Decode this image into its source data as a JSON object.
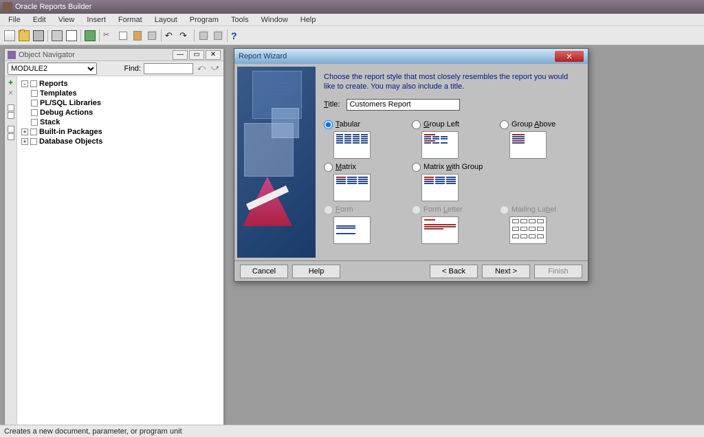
{
  "app": {
    "title": "Oracle Reports Builder"
  },
  "menu": {
    "items": [
      "File",
      "Edit",
      "View",
      "Insert",
      "Format",
      "Layout",
      "Program",
      "Tools",
      "Window",
      "Help"
    ]
  },
  "object_navigator": {
    "title": "Object Navigator",
    "module_selected": "MODULE2",
    "find_label": "Find:",
    "find_value": "",
    "tree": [
      {
        "label": "Reports",
        "bold": true,
        "expand": "-"
      },
      {
        "label": "Templates",
        "bold": true,
        "expand": ""
      },
      {
        "label": "PL/SQL Libraries",
        "bold": true,
        "expand": ""
      },
      {
        "label": "Debug Actions",
        "bold": true,
        "expand": ""
      },
      {
        "label": "Stack",
        "bold": true,
        "expand": ""
      },
      {
        "label": "Built-in Packages",
        "bold": true,
        "expand": "+"
      },
      {
        "label": "Database Objects",
        "bold": true,
        "expand": "+"
      }
    ]
  },
  "wizard": {
    "title": "Report Wizard",
    "description": "Choose the report style that most closely resembles the report you would like to create. You may also include a title.",
    "title_label": "Title:",
    "title_value": "Customers Report",
    "styles": [
      {
        "key": "tabular",
        "label": "Tabular",
        "accel": "T",
        "selected": true,
        "enabled": true
      },
      {
        "key": "group_left",
        "label": "Group Left",
        "accel": "G",
        "selected": false,
        "enabled": true
      },
      {
        "key": "group_above",
        "label": "Group Above",
        "accel": "A",
        "selected": false,
        "enabled": true
      },
      {
        "key": "matrix",
        "label": "Matrix",
        "accel": "M",
        "selected": false,
        "enabled": true
      },
      {
        "key": "matrix_group",
        "label": "Matrix with Group",
        "accel": "w",
        "selected": false,
        "enabled": true
      },
      {
        "key": "spacer",
        "label": "",
        "selected": false,
        "enabled": false,
        "hidden": true
      },
      {
        "key": "form",
        "label": "Form",
        "accel": "F",
        "selected": false,
        "enabled": false
      },
      {
        "key": "form_letter",
        "label": "Form Letter",
        "accel": "L",
        "selected": false,
        "enabled": false
      },
      {
        "key": "mailing_label",
        "label": "Mailing Label",
        "accel": "b",
        "selected": false,
        "enabled": false
      }
    ],
    "buttons": {
      "cancel": "Cancel",
      "help": "Help",
      "back": "< Back",
      "next": "Next >",
      "finish": "Finish"
    }
  },
  "status": {
    "text": "Creates a new document, parameter, or program unit"
  }
}
